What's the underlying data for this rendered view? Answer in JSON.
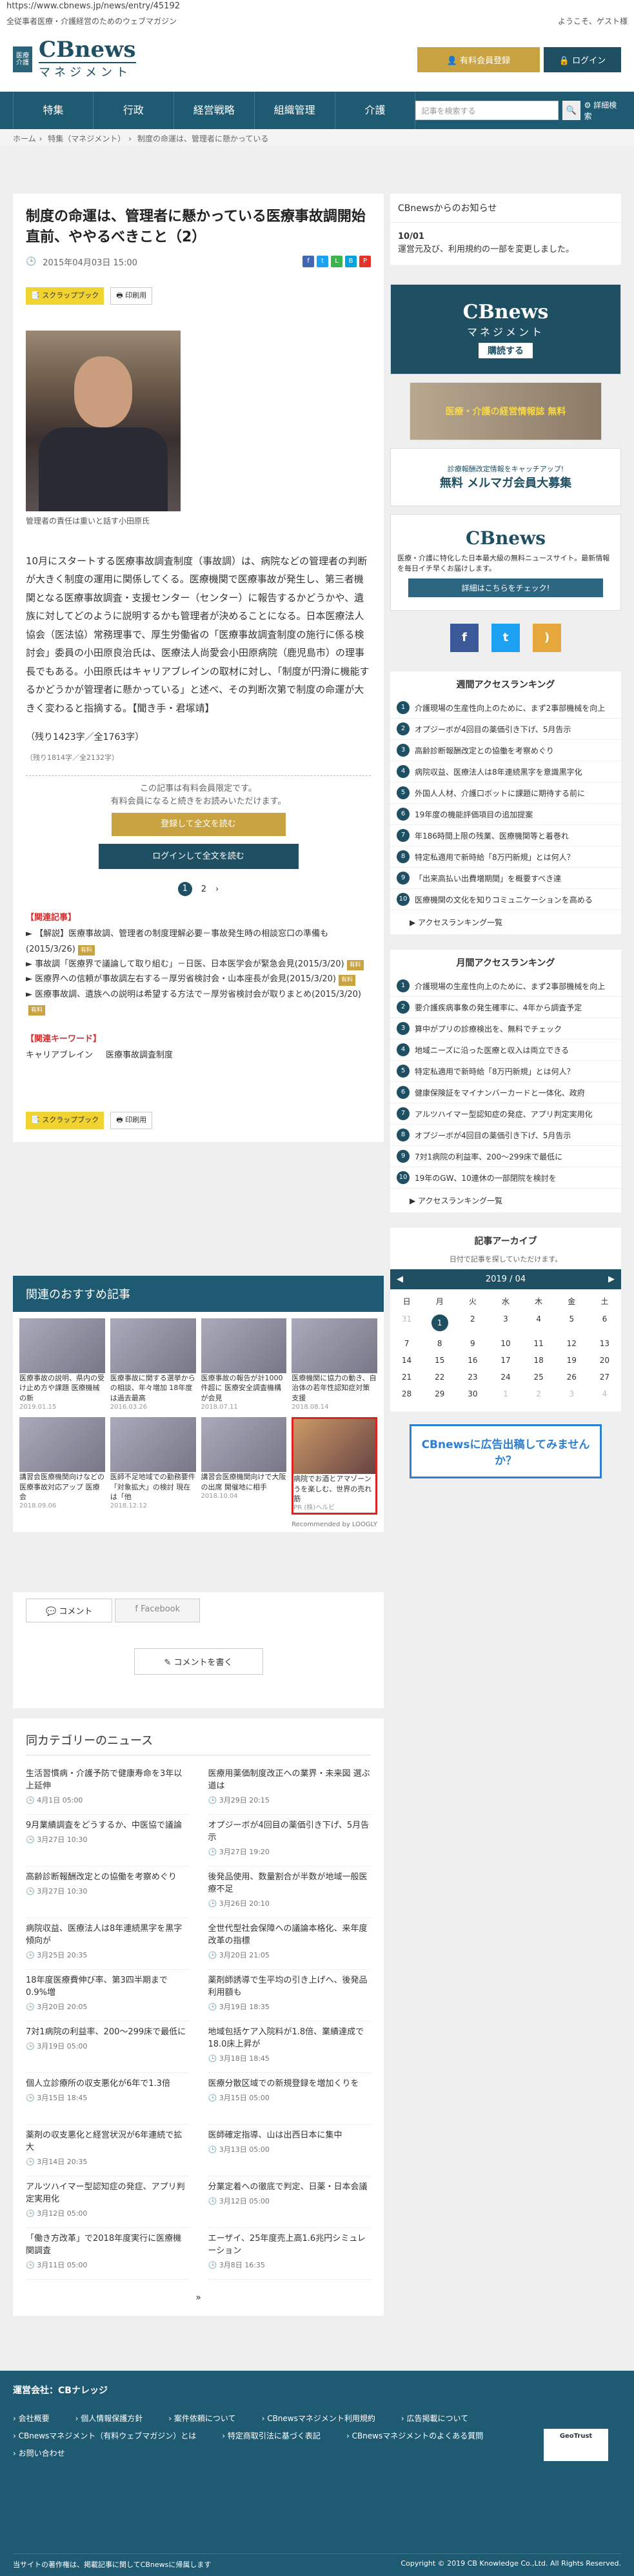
{
  "url": "https://www.cbnews.jp/news/entry/45192",
  "tagline": "全従事者医療・介護経営のためのウェブマガジン",
  "welcome": "ようこそ、ゲスト様",
  "logo": {
    "badge1": "医療",
    "badge2": "介護",
    "main": "CBnews",
    "sub": "マネジメント"
  },
  "auth": {
    "register": "有料会員登録",
    "login": "ログイン"
  },
  "nav": [
    "特集",
    "行政",
    "経営戦略",
    "組織管理",
    "介護"
  ],
  "search": {
    "placeholder": "記事を検索する",
    "advanced": "詳細検索"
  },
  "breadcrumb": [
    "ホーム",
    "特集（マネジメント）",
    "制度の命運は、管理者に懸かっている"
  ],
  "article": {
    "title": "制度の命運は、管理者に懸かっている医療事故調開始直前、ややるべきこと（2）",
    "date": "2015年04月03日 15:00",
    "scrapbook": "スクラップブック",
    "print": "印刷用",
    "caption": "管理者の責任は重いと話す小田原氏",
    "body": "10月にスタートする医療事故調査制度（事故調）は、病院などの管理者の判断が大きく制度の運用に関係してくる。医療機関で医療事故が発生し、第三者機関となる医療事故調査・支援センター（センター）に報告するかどうかや、遺族に対してどのように説明するかも管理者が決めることになる。日本医療法人協会（医法協）常務理事で、厚生労働省の「医療事故調査制度の施行に係る検討会」委員の小田原良治氏は、医療法人尚愛会小田原病院（鹿児島市）の理事長でもある。小田原氏はキャリアブレインの取材に対し、「制度が円滑に機能するかどうかが管理者に懸かっている」と述べ、その判断次第で制度の命運が大きく変わると指摘する。【聞き手・君塚靖】",
    "chars": "（残り1423字／全1763字）",
    "chars2": "（残り1814字／全2132字）",
    "paywall_line1": "この記事は有料会員限定です。",
    "paywall_line2": "有料会員になると続きをお読みいただけます。",
    "btn_register": "登録して全文を読む",
    "btn_login": "ログインして全文を読む",
    "pages": [
      "1",
      "2"
    ],
    "related_title": "【関連記事】",
    "related": [
      {
        "t": "【解説】医療事故調、管理者の制度理解必要－事故発生時の相談窓口の準備も(2015/3/26)",
        "tag": "有料"
      },
      {
        "t": "事故調「医療界で議論して取り組む」－日医、日本医学会が緊急会見(2015/3/20)",
        "tag": "有料"
      },
      {
        "t": "医療界への信頼が事故調左右する－厚労省検討会・山本座長が会見(2015/3/20)",
        "tag": "有料"
      },
      {
        "t": "医療事故調、遺族への説明は希望する方法で－厚労省検討会が取りまとめ(2015/3/20)",
        "tag": "有料"
      }
    ],
    "keyword_title": "【関連キーワード】",
    "keywords": [
      "キャリアブレイン",
      "医療事故調査制度"
    ]
  },
  "recommend": {
    "title": "関連のおすすめ記事",
    "items": [
      {
        "t": "医療事故の説明、県内の受け止め方や課題 医療機械の新",
        "d": "2019.01.15"
      },
      {
        "t": "医療事故に関する選挙からの相談、年々増加 18年度は過去最高",
        "d": "2016.03.26"
      },
      {
        "t": "医療事故の報告が計1000件超に 医療安全調査機構が会見",
        "d": "2018.07.11"
      },
      {
        "t": "医療機関に協力の動き、自治体の若年性認知症対策 支援",
        "d": "2018.08.14"
      },
      {
        "t": "講習会医療機関向けなどの医療事故対応アップ 医療会",
        "d": "2018.09.06"
      },
      {
        "t": "医師不足地域での勤務要件「対象拡大」の検討 現在は「他",
        "d": "2018.12.12"
      },
      {
        "t": "講習会医療機関向けで大阪の出席 開催地に相手",
        "d": "2018.10.04"
      },
      {
        "t": "病院でお酒とアマゾーンうを楽しむ、世界の売れ筋",
        "d": "PR (株)ヘルビ"
      }
    ],
    "powered": "Recommended by LOOGLY"
  },
  "comments": {
    "tab1": "コメント",
    "tab2": "Facebook",
    "write": "コメントを書く"
  },
  "samecat": {
    "title": "同カテゴリーのニュース",
    "items": [
      {
        "t": "生活習慣病・介護予防で健康寿命を3年以上延伸",
        "d": "4月1日 05:00"
      },
      {
        "t": "医療用薬価制度改正への業界・未来図 選ぶ道は",
        "d": "3月29日 20:15"
      },
      {
        "t": "9月業績調査をどうするか、中医協で議論",
        "d": "3月27日 10:30"
      },
      {
        "t": "オプジーボが4回目の薬価引き下げ、5月告示",
        "d": "3月27日 19:20"
      },
      {
        "t": "高齢診断報酬改定との協働を考察めぐり",
        "d": "3月27日 10:30"
      },
      {
        "t": "後発品使用、数量割合が半数が地域一般医療不足",
        "d": "3月26日 20:10"
      },
      {
        "t": "病院収益、医療法人は8年連続黒字を黒字傾向が",
        "d": "3月25日 20:35"
      },
      {
        "t": "全世代型社会保障への議論本格化、来年度改革の指標",
        "d": "3月20日 21:05"
      },
      {
        "t": "18年度医療費伸び率、第3四半期まで0.9%増",
        "d": "3月20日 20:05"
      },
      {
        "t": "薬剤師誘導で生平均の引き上げへ、後発品利用額も",
        "d": "3月19日 18:35"
      },
      {
        "t": "7対1病院の利益率、200～299床で最低に",
        "d": "3月19日 05:00"
      },
      {
        "t": "地域包括ケア入院料が1.8倍、業績達成で18.0床上昇が",
        "d": "3月18日 18:45"
      },
      {
        "t": "個人立診療所の収支悪化が6年で1.3倍",
        "d": "3月15日 18:45"
      },
      {
        "t": "医療分散区域での新規登録を増加くりを",
        "d": "3月15日 05:00"
      },
      {
        "t": "薬剤の収支悪化と経営状況が6年連続で拡大",
        "d": "3月14日 20:35"
      },
      {
        "t": "医師確定指導、山は出西日本に集中",
        "d": "3月13日 05:00"
      },
      {
        "t": "アルツハイマー型認知症の発症、アプリ判定実用化",
        "d": "3月12日 05:00"
      },
      {
        "t": "分業定着への徹底で判定、日薬・日本会議",
        "d": "3月12日 05:00"
      },
      {
        "t": "「働き方改革」で2018年度実行に医療機関調査",
        "d": "3月11日 05:00"
      },
      {
        "t": "エーザイ、25年度売上高1.6兆円シミュレーション",
        "d": "3月8日 16:35"
      }
    ],
    "more": "»"
  },
  "sidebar": {
    "notice_title": "CBnewsからのお知らせ",
    "notice_date": "10/01",
    "notice_text": "運営元及び、利用規約の一部を変更しました。",
    "ad1_title": "CBnews",
    "ad1_sub": "マネジメント",
    "ad1_cta": "購読する",
    "ad2": "医療・介護の経営情報誌 無料",
    "ad3_title": "無料 メルマガ会員大募集",
    "ad3_sub": "診療報酬改定情報をキャッチアップ!",
    "ad4_text": "医療・介護に特化した日本最大級の無料ニュースサイト。最新情報を毎日イチ早くお届けします。",
    "ad4_btn": "詳細はこちらをチェック!",
    "weekly_title": "週間アクセスランキング",
    "weekly": [
      "介護現場の生産性向上のために、まず2事部機械を向上",
      "オプジーボが4回目の薬価引き下げ、5月告示",
      "高齢診断報酬改定との協働を考察めぐり",
      "病院収益、医療法人は8年連続黒字を意識黒字化",
      "外国人人材、介護口ボットに課題に期待する前に",
      "19年度の機能評価項目の追加提案",
      "年186時間上限の残業、医療機関等と着巻れ",
      "特定私適用で新時給「8万円新規」とは何人？",
      "「出来高払い出費増期間」を概要すべき達",
      "医療機関の文化を知りコミュニケーションを高める"
    ],
    "monthly_title": "月間アクセスランキング",
    "monthly": [
      "介護現場の生産性向上のために、まず2事部機械を向上",
      "要介護疾病事象の発生確率に、4年から調査予定",
      "算中がプリの診療検出を、無料でチェック",
      "地域ニーズに沿った医療と収入は両立できる",
      "特定私適用で新時給「8万円新規」とは何人？",
      "健康保険証をマイナンバーカードと一体化、政府",
      "アルツハイマー型認知症の発症、アプリ判定実用化",
      "オプジーボが4回目の薬価引き下げ、5月告示",
      "7対1病院の利益率、200～299床で最低に",
      "19年のGW、10連休の一部閉院を検討を"
    ],
    "ranking_more": "アクセスランキング一覧",
    "archive_title": "記事アーカイブ",
    "archive_sub": "日付で記事を探していただけます。",
    "cal_month": "2019 / 04",
    "cal_days": [
      "日",
      "月",
      "火",
      "水",
      "木",
      "金",
      "土"
    ],
    "cal_cells": [
      "31",
      "1",
      "2",
      "3",
      "4",
      "5",
      "6",
      "7",
      "8",
      "9",
      "10",
      "11",
      "12",
      "13",
      "14",
      "15",
      "16",
      "17",
      "18",
      "19",
      "20",
      "21",
      "22",
      "23",
      "24",
      "25",
      "26",
      "27",
      "28",
      "29",
      "30",
      "1",
      "2",
      "3",
      "4"
    ],
    "ad5": "CBnewsに広告出稿してみませんか？"
  },
  "footer": {
    "title": "運営会社：CBナレッジ",
    "links": [
      "会社概要",
      "個人情報保護方針",
      "案件依頼について",
      "CBnewsマネジメント利用規約",
      "広告掲載について",
      "CBnewsマネジメント（有料ウェブマガジン）とは",
      "特定商取引法に基づく表記",
      "CBnewsマネジメントのよくある質問",
      "お問い合わせ"
    ],
    "copy_left": "当サイトの著作権は、掲載記事に関してCBnewsに帰属します",
    "copy_right": "Copyright © 2019 CB Knowledge Co.,Ltd. All Rights Reserved.",
    "geotrust": "GeoTrust"
  }
}
